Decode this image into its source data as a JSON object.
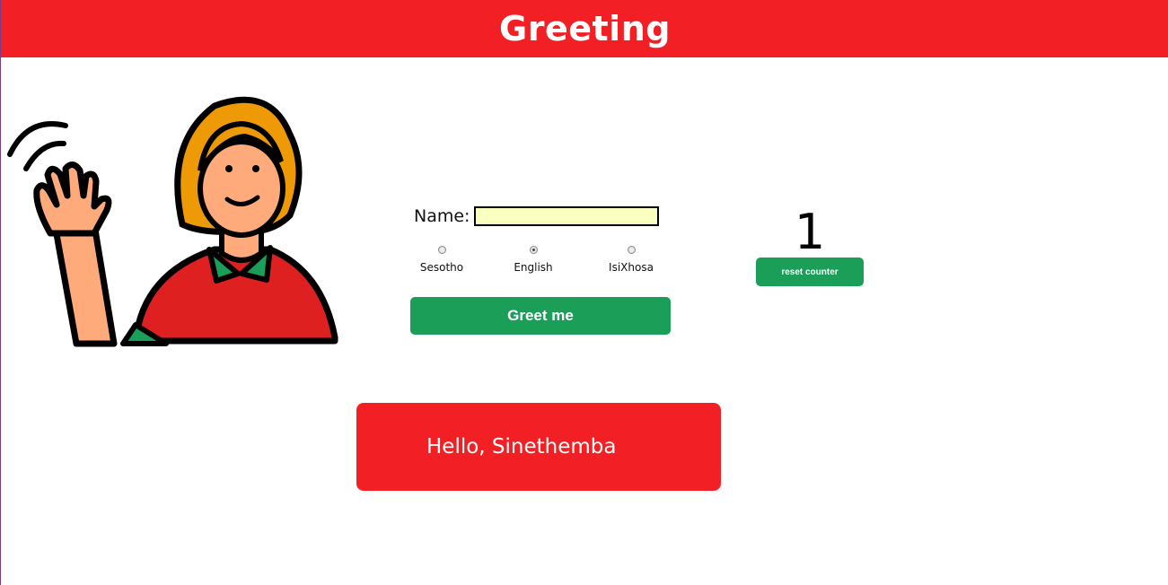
{
  "header": {
    "title": "Greeting"
  },
  "illustration": {
    "name": "waving-woman"
  },
  "form": {
    "name_label": "Name:",
    "name_value": "",
    "languages": [
      {
        "label": "Sesotho",
        "checked": false
      },
      {
        "label": "English",
        "checked": true
      },
      {
        "label": "IsiXhosa",
        "checked": false
      }
    ],
    "greet_button": "Greet me"
  },
  "counter": {
    "value": "1",
    "reset_button": "reset counter"
  },
  "message": {
    "text": "Hello, Sinethemba"
  },
  "colors": {
    "brand_red": "#f22024",
    "button_green": "#1a9e58",
    "input_yellow": "#fbffc0"
  }
}
